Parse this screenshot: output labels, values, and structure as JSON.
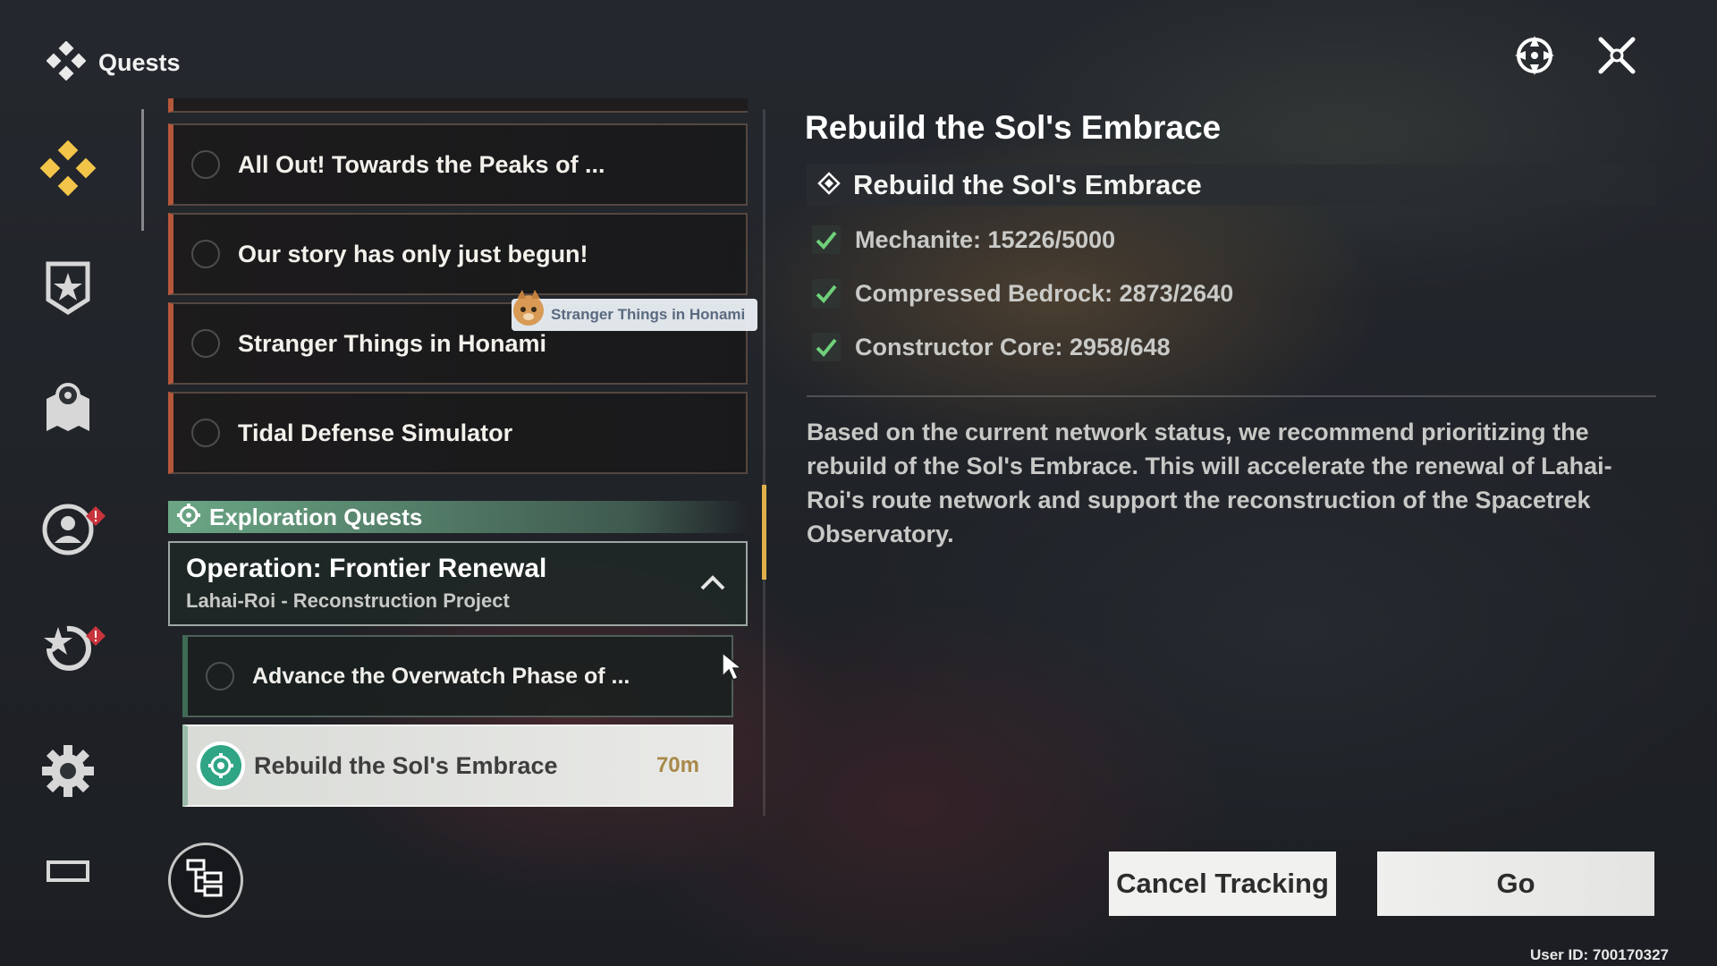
{
  "header": {
    "title": "Quests"
  },
  "quests": [
    {
      "label": "All Out! Towards the Peaks of ..."
    },
    {
      "label": "Our story has only just begun!"
    },
    {
      "label": "Stranger Things in Honami"
    },
    {
      "label": "Tidal Defense Simulator"
    }
  ],
  "tag": {
    "label": "Stranger Things in Honami"
  },
  "exploration": {
    "section_label": "Exploration Quests",
    "group_name": "Operation: Frontier Renewal",
    "group_sub": "Lahai-Roi - Reconstruction Project",
    "subquest_label": "Advance the Overwatch Phase of ...",
    "active_label": "Rebuild the Sol's Embrace",
    "active_time": "70m"
  },
  "detail": {
    "title": "Rebuild the Sol's Embrace",
    "objective": "Rebuild the Sol's Embrace",
    "requirements": [
      {
        "label": "Mechanite: 15226/5000"
      },
      {
        "label": "Compressed Bedrock: 2873/2640"
      },
      {
        "label": "Constructor Core: 2958/648"
      }
    ],
    "description": "Based on the current network status, we recommend prioritizing the rebuild of the Sol's Embrace. This will accelerate the renewal of Lahai-Roi's route network and support the reconstruction of the Spacetrek Observatory."
  },
  "buttons": {
    "cancel_label": "Cancel Tracking",
    "go_label": "Go"
  },
  "footer": {
    "user_id": "User ID: 700170327"
  },
  "icons": {
    "header": "quests-diamond-icon",
    "top": [
      "target-crosshair-icon",
      "close-icon"
    ],
    "sidebar": [
      "quests-diamond-icon",
      "badge-shield-icon",
      "map-pin-icon",
      "character-icon",
      "star-refresh-icon",
      "gear-icon",
      "screen-icon"
    ]
  },
  "colors": {
    "accent_gold": "#e0b14a",
    "exploration_green": "#78be96",
    "check_green": "#6fd17a",
    "alert_red": "#c8343c",
    "active_teal": "#2fa586"
  }
}
